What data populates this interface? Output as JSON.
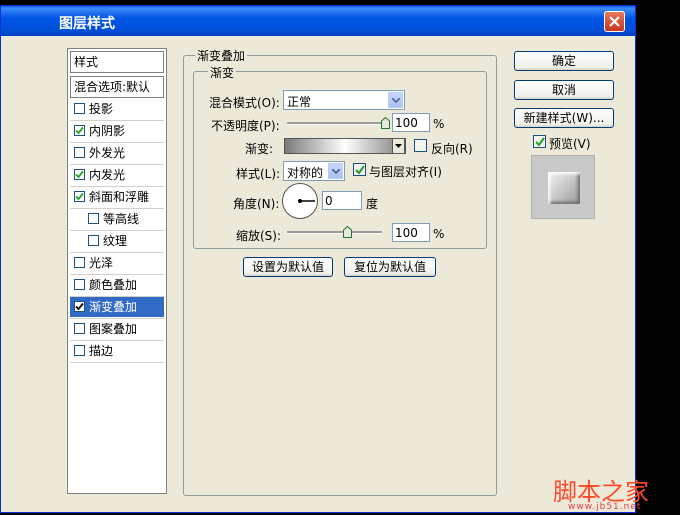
{
  "window": {
    "title": "图层样式"
  },
  "sidebar": {
    "header": "样式",
    "blend_options": "混合选项:默认",
    "items": [
      {
        "label": "投影",
        "checked": false,
        "indent": false,
        "checkbox": true
      },
      {
        "label": "内阴影",
        "checked": true,
        "indent": false,
        "checkbox": true
      },
      {
        "label": "外发光",
        "checked": false,
        "indent": false,
        "checkbox": true
      },
      {
        "label": "内发光",
        "checked": true,
        "indent": false,
        "checkbox": true
      },
      {
        "label": "斜面和浮雕",
        "checked": true,
        "indent": false,
        "checkbox": true
      },
      {
        "label": "等高线",
        "checked": false,
        "indent": true,
        "checkbox": true
      },
      {
        "label": "纹理",
        "checked": false,
        "indent": true,
        "checkbox": true
      },
      {
        "label": "光泽",
        "checked": false,
        "indent": false,
        "checkbox": true
      },
      {
        "label": "颜色叠加",
        "checked": false,
        "indent": false,
        "checkbox": true
      },
      {
        "label": "渐变叠加",
        "checked": true,
        "indent": false,
        "checkbox": true,
        "selected": true
      },
      {
        "label": "图案叠加",
        "checked": false,
        "indent": false,
        "checkbox": true
      },
      {
        "label": "描边",
        "checked": false,
        "indent": false,
        "checkbox": true
      }
    ]
  },
  "panel": {
    "outer_legend": "渐变叠加",
    "inner_legend": "渐变",
    "blend_mode_label": "混合模式(O):",
    "blend_mode_value": "正常",
    "opacity_label": "不透明度(P):",
    "opacity_value": "100",
    "opacity_unit": "%",
    "opacity_level": 1.0,
    "gradient_label": "渐变:",
    "reverse_label": "反向(R)",
    "reverse_checked": false,
    "style_label": "样式(L):",
    "style_value": "对称的",
    "align_label": "与图层对齐(I)",
    "align_checked": true,
    "angle_label": "角度(N):",
    "angle_value": "0",
    "angle_unit": "度",
    "scale_label": "缩放(S):",
    "scale_value": "100",
    "scale_unit": "%",
    "scale_level": 0.5,
    "set_default_label": "设置为默认值",
    "reset_default_label": "复位为默认值"
  },
  "buttons": {
    "ok": "确定",
    "cancel": "取消",
    "new_style": "新建样式(W)...",
    "preview_label": "预览(V)",
    "preview_checked": true
  },
  "watermark": {
    "text": "脚本之家",
    "url": "www.jb51.net"
  }
}
